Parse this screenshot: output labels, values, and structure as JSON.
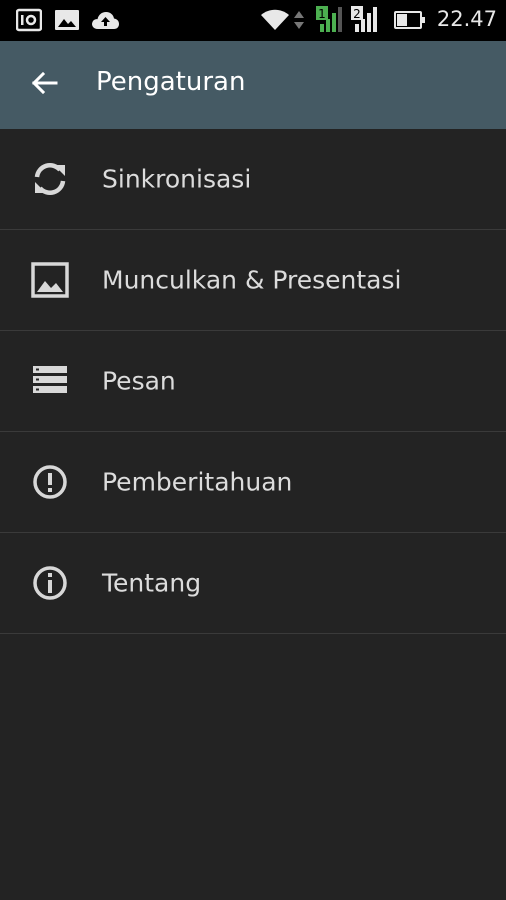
{
  "status_bar": {
    "time": "22.47",
    "sim1_label": "1",
    "sim2_label": "2",
    "icons": [
      "debug-icon",
      "image-notification-icon",
      "cloud-upload-icon",
      "wifi-icon",
      "data-arrows-icon",
      "signal-sim1-icon",
      "signal-sim2-icon",
      "battery-icon"
    ]
  },
  "app_bar": {
    "title": "Pengaturan",
    "back_icon": "arrow-back-icon",
    "background_color": "#455a64"
  },
  "settings": {
    "items": [
      {
        "label": "Sinkronisasi",
        "icon": "sync-icon"
      },
      {
        "label": "Munculkan & Presentasi",
        "icon": "image-icon"
      },
      {
        "label": "Pesan",
        "icon": "messages-list-icon"
      },
      {
        "label": "Pemberitahuan",
        "icon": "alert-circle-icon"
      },
      {
        "label": "Tentang",
        "icon": "info-circle-icon"
      }
    ]
  }
}
